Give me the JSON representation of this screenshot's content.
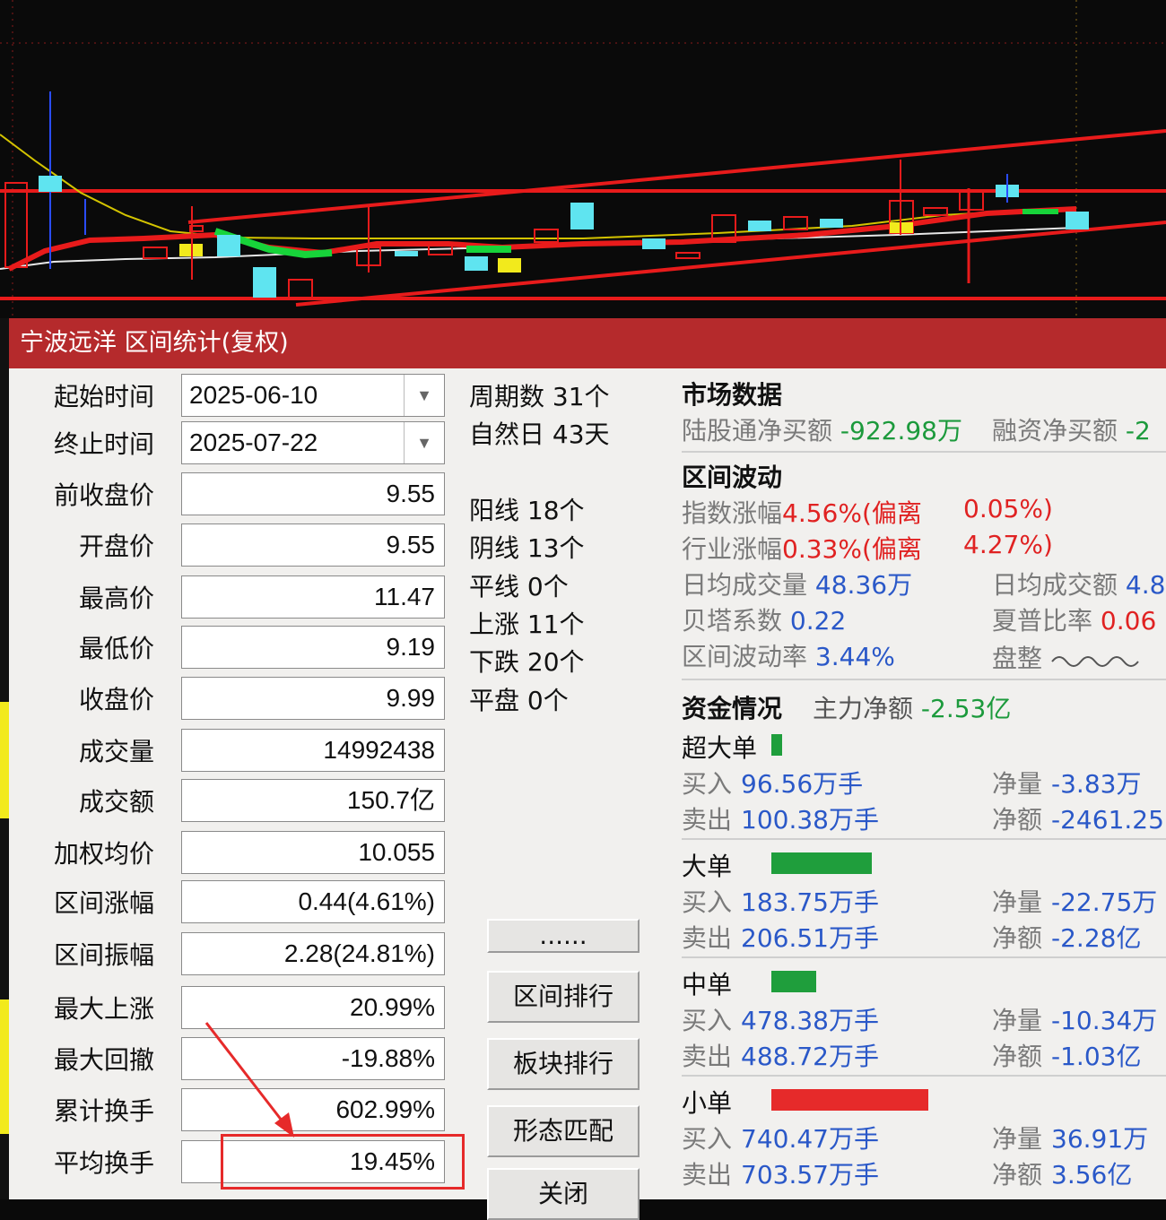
{
  "window": {
    "title": "宁波远洋 区间统计(复权)"
  },
  "fields": [
    {
      "label": "起始时间",
      "value": "2025-06-10",
      "dropdown": true
    },
    {
      "label": "终止时间",
      "value": "2025-07-22",
      "dropdown": true
    },
    {
      "label": "前收盘价",
      "value": "9.55"
    },
    {
      "label": "开盘价",
      "value": "9.55"
    },
    {
      "label": "最高价",
      "value": "11.47"
    },
    {
      "label": "最低价",
      "value": "9.19"
    },
    {
      "label": "收盘价",
      "value": "9.99"
    },
    {
      "label": "成交量",
      "value": "14992438"
    },
    {
      "label": "成交额",
      "value": "150.7亿"
    },
    {
      "label": "加权均价",
      "value": "10.055"
    },
    {
      "label": "区间涨幅",
      "value": "0.44(4.61%)"
    },
    {
      "label": "区间振幅",
      "value": "2.28(24.81%)"
    },
    {
      "label": "最大上涨",
      "value": "20.99%"
    },
    {
      "label": "最大回撤",
      "value": "-19.88%"
    },
    {
      "label": "累计换手",
      "value": "602.99%"
    },
    {
      "label": "平均换手",
      "value": "19.45%"
    }
  ],
  "stats": [
    "周期数 31个",
    "自然日 43天",
    "阳线 18个",
    "阴线 13个",
    "平线 0个",
    "上涨 11个",
    "下跌 20个",
    "平盘 0个"
  ],
  "buttons": {
    "more": "......",
    "rank": "区间排行",
    "sector": "板块排行",
    "pattern": "形态匹配",
    "close": "关闭"
  },
  "market": {
    "heading": "市场数据",
    "hk_label": "陆股通净买额",
    "hk_value": "-922.98万",
    "margin_label": "融资净买额",
    "margin_value": "-2"
  },
  "volatility": {
    "heading": "区间波动",
    "index_label": "指数涨幅",
    "index_value": "4.56%",
    "index_dev_label": "(偏离",
    "index_dev_value": "0.05%)",
    "industry_label": "行业涨幅",
    "industry_value": "0.33%",
    "industry_dev_label": "(偏离",
    "industry_dev_value": "4.27%)",
    "avgvol_label": "日均成交量",
    "avgvol_value": "48.36万",
    "avgamt_label": "日均成交额",
    "avgamt_value": "4.8",
    "beta_label": "贝塔系数",
    "beta_value": "0.22",
    "sharpe_label": "夏普比率",
    "sharpe_value": "0.06",
    "vol_label": "区间波动率",
    "vol_value": "3.44%",
    "trend_label": "盘整"
  },
  "capital": {
    "heading": "资金情况",
    "main_label": "主力净额",
    "main_value": "-2.53亿",
    "groups": [
      {
        "name": "超大单",
        "buy_label": "买入",
        "buy": "96.56万手",
        "sell_label": "卖出",
        "sell": "100.38万手",
        "net_qty_label": "净量",
        "net_qty": "-3.83万",
        "net_amt_label": "净额",
        "net_amt": "-2461.25",
        "bar_color": "#1f9e3c"
      },
      {
        "name": "大单",
        "buy_label": "买入",
        "buy": "183.75万手",
        "sell_label": "卖出",
        "sell": "206.51万手",
        "net_qty_label": "净量",
        "net_qty": "-22.75万",
        "net_amt_label": "净额",
        "net_amt": "-2.28亿",
        "bar_color": "#1f9e3c"
      },
      {
        "name": "中单",
        "buy_label": "买入",
        "buy": "478.38万手",
        "sell_label": "卖出",
        "sell": "488.72万手",
        "net_qty_label": "净量",
        "net_qty": "-10.34万",
        "net_amt_label": "净额",
        "net_amt": "-1.03亿",
        "bar_color": "#1f9e3c"
      },
      {
        "name": "小单",
        "buy_label": "买入",
        "buy": "740.47万手",
        "sell_label": "卖出",
        "sell": "703.57万手",
        "net_qty_label": "净量",
        "net_qty": "36.91万",
        "net_amt_label": "净额",
        "net_amt": "3.56亿",
        "bar_color": "#e62a2a"
      }
    ]
  },
  "colors": {
    "title_bar": "#b52a2c",
    "up": "#e02222",
    "down": "#1c9a3c",
    "value_blue": "#2a58c8"
  }
}
